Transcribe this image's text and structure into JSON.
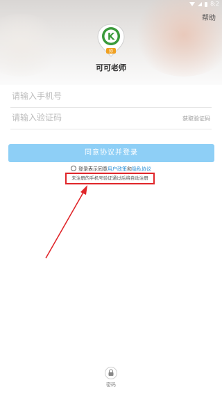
{
  "status_bar": {
    "time": "8:2"
  },
  "header": {
    "help_label": "帮助"
  },
  "app": {
    "name": "可可老师",
    "logo_letter": "K",
    "logo_badge": "师",
    "brand_green": "#3a9a3a",
    "accent_orange": "#f0a020"
  },
  "form": {
    "phone_placeholder": "请输入手机号",
    "code_placeholder": "请输入验证码",
    "get_code_label": "获取验证码",
    "login_button": "同意协议并登录",
    "agreement_prefix": "登录表示同意",
    "user_policy": "用户政策",
    "and": "和",
    "privacy": "隐私协议",
    "auto_register_notice": "未注册的手机号验证通过后将自动注册"
  },
  "footer": {
    "password_login_label": "密码"
  },
  "colors": {
    "login_button": "#8ecff6",
    "link": "#2b8fd6",
    "annotation_red": "#e0262a"
  }
}
